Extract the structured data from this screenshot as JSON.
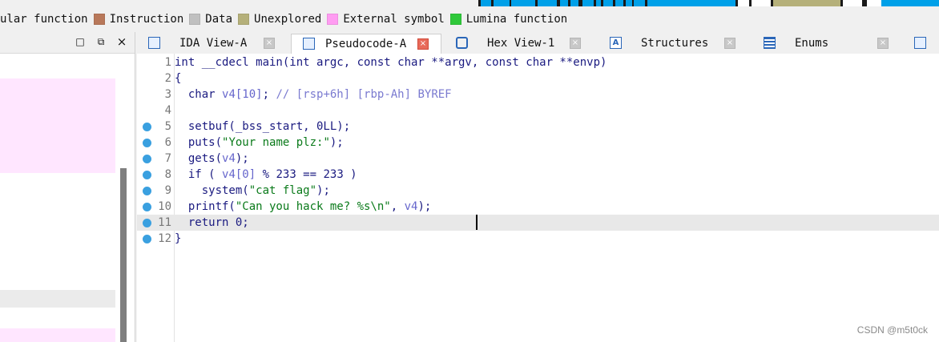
{
  "legend": {
    "items": [
      {
        "label": "ular function",
        "color": ""
      },
      {
        "label": "Instruction",
        "color": "#b8785a"
      },
      {
        "label": "Data",
        "color": "#c0c0c0"
      },
      {
        "label": "Unexplored",
        "color": "#b5b07a"
      },
      {
        "label": "External symbol",
        "color": "#ff9cf2"
      },
      {
        "label": "Lumina function",
        "color": "#2fc83a"
      }
    ]
  },
  "left_pane": {
    "title": "",
    "maximize_icon": "□",
    "restore_icon": "⧉",
    "close_icon": "×"
  },
  "tabs": [
    {
      "label": "IDA View-A",
      "icon": "listing-icon",
      "active": false
    },
    {
      "label": "Pseudocode-A",
      "icon": "pseudocode-icon",
      "active": true
    },
    {
      "label": "Hex View-1",
      "icon": "hex-icon",
      "active": false
    },
    {
      "label": "Structures",
      "icon": "structures-icon",
      "active": false
    },
    {
      "label": "Enums",
      "icon": "enums-icon",
      "active": false
    }
  ],
  "tab_close_glyph": "×",
  "code": {
    "lines": [
      {
        "num": "1",
        "text": "int __cdecl main(int argc, const char **argv, const char **envp)",
        "dot": false
      },
      {
        "num": "2",
        "text": "{",
        "dot": false
      },
      {
        "num": "3",
        "text": "  char v4[10]; // [rsp+6h] [rbp-Ah] BYREF",
        "dot": false
      },
      {
        "num": "4",
        "text": "",
        "dot": false
      },
      {
        "num": "5",
        "text": "  setbuf(_bss_start, 0LL);",
        "dot": true
      },
      {
        "num": "6",
        "text": "  puts(\"Your name plz:\");",
        "dot": true
      },
      {
        "num": "7",
        "text": "  gets(v4);",
        "dot": true
      },
      {
        "num": "8",
        "text": "  if ( v4[0] % 233 == 233 )",
        "dot": true
      },
      {
        "num": "9",
        "text": "    system(\"cat flag\");",
        "dot": true
      },
      {
        "num": "10",
        "text": "  printf(\"Can you hack me? %s\\n\", v4);",
        "dot": true
      },
      {
        "num": "11",
        "text": "  return 0;",
        "dot": true
      },
      {
        "num": "12",
        "text": "}",
        "dot": true
      }
    ],
    "highlighted_line": "11"
  },
  "watermark": "CSDN @m5t0ck"
}
